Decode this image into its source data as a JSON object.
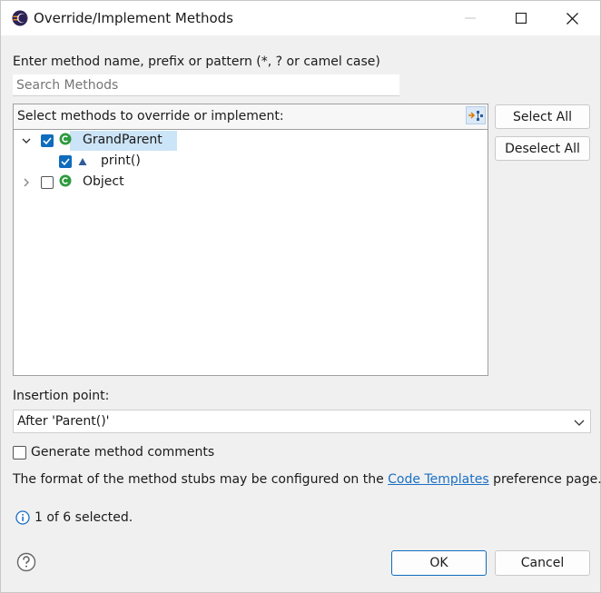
{
  "window": {
    "title": "Override/Implement Methods"
  },
  "prompt_label": "Enter method name, prefix or pattern (*, ? or camel case)",
  "search": {
    "placeholder": "Search Methods",
    "value": ""
  },
  "tree": {
    "header": "Select methods to override or implement:",
    "nodes": [
      {
        "label": "GrandParent",
        "checked": true,
        "expanded": true,
        "selected": true,
        "children": [
          {
            "label": "print()",
            "checked": true
          }
        ]
      },
      {
        "label": "Object",
        "checked": false,
        "expanded": false
      }
    ]
  },
  "buttons": {
    "select_all": "Select All",
    "deselect_all": "Deselect All",
    "ok": "OK",
    "cancel": "Cancel"
  },
  "insertion": {
    "label": "Insertion point:",
    "selected": "After 'Parent()'"
  },
  "generate_comments": {
    "label": "Generate method comments",
    "checked": false
  },
  "format_text": {
    "before": "The format of the method stubs may be configured on the ",
    "link": "Code Templates",
    "after": " preference page."
  },
  "status": "1 of 6 selected.",
  "colors": {
    "accent": "#0f6cbd",
    "link": "#1a6fc4",
    "class_icon": "#2e9a3e",
    "method_icon": "#2f5c99"
  }
}
